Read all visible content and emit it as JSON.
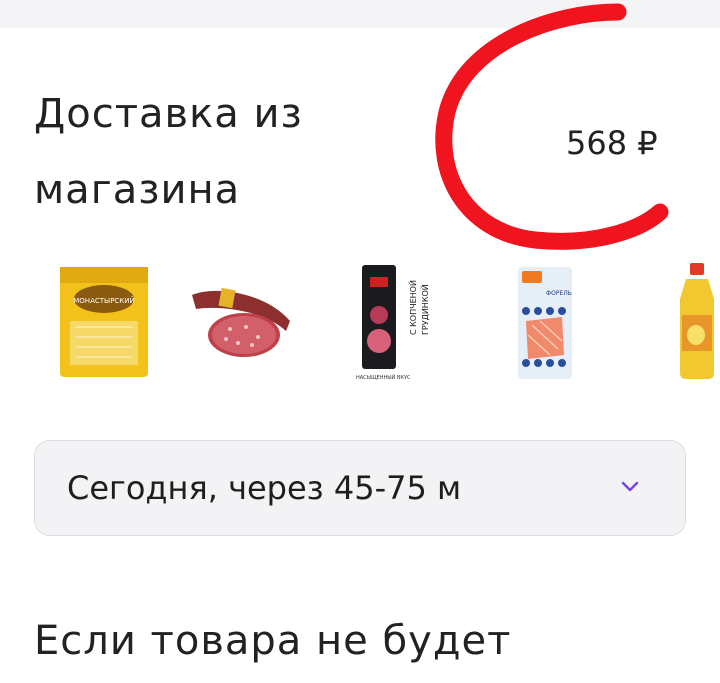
{
  "delivery": {
    "title_line1": "Доставка из",
    "title_line2": "магазина",
    "price": "568 ₽"
  },
  "products": [
    {
      "icon": "cheese-package-icon",
      "label": "МОНАСТЫРСКИЙ"
    },
    {
      "icon": "sausage-icon",
      "label": ""
    },
    {
      "icon": "salami-pack-icon",
      "label": "С КОПЧЕНОЙ ГРУДИНКОЙ",
      "sub": "НАСЫЩЕННЫЙ ВКУС"
    },
    {
      "icon": "trout-pack-icon",
      "label": "ФОРЕЛЬ"
    },
    {
      "icon": "juice-bottle-icon",
      "label": ""
    }
  ],
  "delivery_time": {
    "selected": "Сегодня, через 45-75 м"
  },
  "section": {
    "if_missing": "Если товара не будет"
  },
  "colors": {
    "annotation": "#f0141e",
    "cheese": "#f2c21a",
    "sausage": "#c0404a",
    "chevron": "#7b3fe4"
  }
}
